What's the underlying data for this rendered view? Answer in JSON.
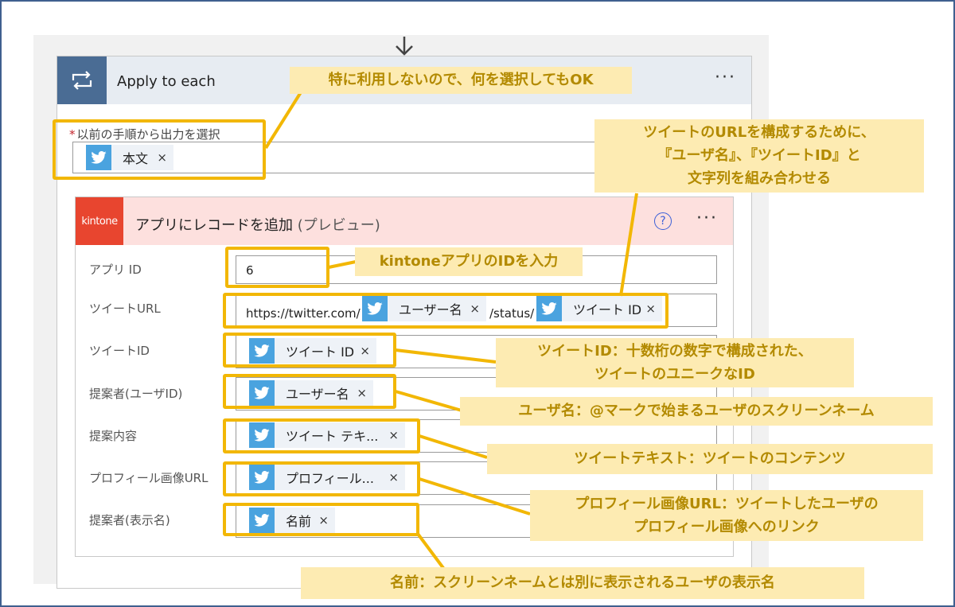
{
  "loop": {
    "title": "Apply to each",
    "more": "···",
    "required_star": "*",
    "output_label": "以前の手順から出力を選択",
    "output_token": "本文"
  },
  "kintone_action": {
    "logo_text": "kintone",
    "title": "アプリにレコードを追加",
    "title_suffix": "(プレビュー)",
    "help_symbol": "?",
    "more": "···",
    "fields": [
      {
        "label": "アプリ ID",
        "value": "6"
      },
      {
        "label": "ツイートURL",
        "prefix": "https://twitter.com/",
        "token1": "ユーザー名",
        "middle": "/status/",
        "token2": "ツイート ID"
      },
      {
        "label": "ツイートID",
        "token": "ツイート ID"
      },
      {
        "label": "提案者(ユーザID)",
        "token": "ユーザー名"
      },
      {
        "label": "提案内容",
        "token": "ツイート テキ..."
      },
      {
        "label": "プロフィール画像URL",
        "token": "プロフィール..."
      },
      {
        "label": "提案者(表示名)",
        "token": "名前"
      }
    ]
  },
  "remove_symbol": "×",
  "annotations": {
    "loop_output": "特に利用しないので、何を選択してもOK",
    "tweet_url": [
      "ツイートのURLを構成するために、",
      "『ユーザ名』、『ツイートID』と",
      "文字列を組み合わせる"
    ],
    "app_id": "kintoneアプリのIDを入力",
    "tweet_id": [
      "ツイートID：十数桁の数字で構成された、",
      "ツイートのユニークなID"
    ],
    "user_name": "ユーザ名：@マークで始まるユーザのスクリーンネーム",
    "tweet_text": "ツイートテキスト：ツイートのコンテンツ",
    "profile_image": [
      "プロフィール画像URL：ツイートしたユーザの",
      "プロフィール画像へのリンク"
    ],
    "display_name": "名前：スクリーンネームとは別に表示されるユーザの表示名"
  },
  "colors": {
    "highlight": "#f2b705",
    "note_bg": "#fdebb2",
    "note_text": "#b38a00",
    "loop_header": "#4a6c94",
    "kintone_brand": "#e8452f",
    "kintone_header": "#fde0de",
    "twitter": "#4aa3df"
  }
}
